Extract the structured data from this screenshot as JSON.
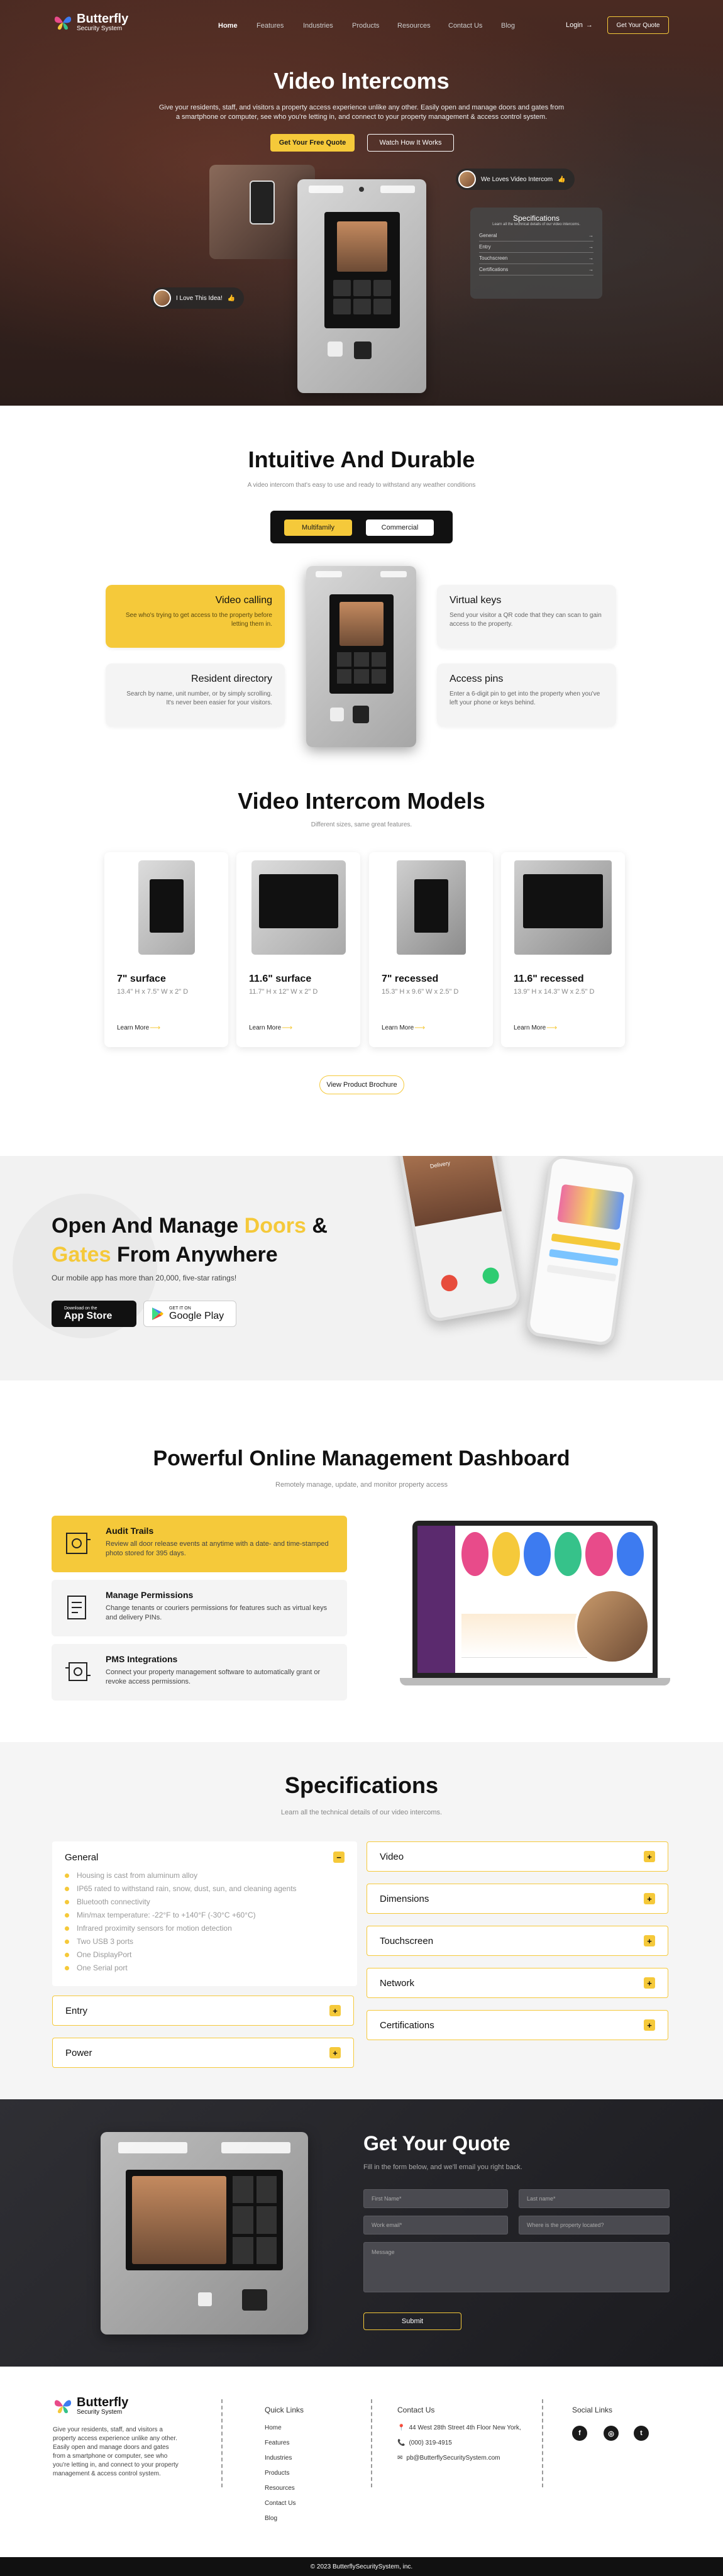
{
  "brand": {
    "name": "Butterfly",
    "tagline": "Security System"
  },
  "nav": {
    "items": [
      "Home",
      "Features",
      "Industries",
      "Products",
      "Resources",
      "Contact Us",
      "Blog"
    ],
    "login": "Login",
    "cta": "Get Your Quote"
  },
  "hero": {
    "title": "Video Intercoms",
    "subtitle": "Give your residents, staff, and visitors a property access experience unlike any other. Easily open and manage doors and gates from a smartphone or computer, see who you're letting in, and connect to your property management & access control system.",
    "primary_btn": "Get Your Free Quote",
    "secondary_btn": "Watch How It Works",
    "pill_right": "We Loves Video Intercom",
    "pill_left": "I Love This Idea!",
    "spec_card": {
      "title": "Specifications",
      "subtitle": "Learn all the technical details of our video intercoms.",
      "rows": [
        "General",
        "Entry",
        "Touchscreen",
        "Certifications"
      ]
    }
  },
  "durable": {
    "title": "Intuitive And Durable",
    "subtitle": "A video intercom that's easy to use and ready to withstand any weather conditions",
    "toggle": [
      "Multifamily",
      "Commercial"
    ],
    "features": [
      {
        "title": "Video calling",
        "text": "See who's trying to get access to the property before letting them in."
      },
      {
        "title": "Virtual keys",
        "text": "Send your visitor a QR code that they can scan to gain access to the property."
      },
      {
        "title": "Resident directory",
        "text": "Search by name, unit number, or by simply scrolling. It's never been easier for your visitors."
      },
      {
        "title": "Access pins",
        "text": "Enter a 6-digit pin to get into the property when you've left your phone or keys behind."
      }
    ]
  },
  "models": {
    "title": "Video Intercom Models",
    "subtitle": "Different sizes, same great features.",
    "items": [
      {
        "name": "7\" surface",
        "dims": "13.4\" H x 7.5\" W x 2\" D",
        "link": "Learn More"
      },
      {
        "name": "11.6\" surface",
        "dims": "11.7\" H x 12\" W x 2\" D",
        "link": "Learn More"
      },
      {
        "name": "7\" recessed",
        "dims": "15.3\" H x 9.6\" W x 2.5\" D",
        "link": "Learn More"
      },
      {
        "name": "11.6\" recessed",
        "dims": "13.9\" H x 14.3\" W x 2.5\" D",
        "link": "Learn More"
      }
    ],
    "brochure_btn": "View Product Brochure"
  },
  "app": {
    "title_a": "Open And Manage ",
    "title_hl1": "Doors",
    "title_b": " & ",
    "title_hl2": "Gates",
    "title_c": " From Anywhere",
    "subtitle": "Our mobile app has more than 20,000, five-star ratings!",
    "app_store": {
      "small": "Download on the",
      "big": "App Store"
    },
    "google_play": {
      "small": "GET IT ON",
      "big": "Google Play"
    },
    "phone_label": "Delivery",
    "colors": {
      "accent": "#f5c93a",
      "call_accept": "#2ecc71",
      "call_decline": "#e74c3c"
    }
  },
  "dashboard": {
    "title": "Powerful Online Management Dashboard",
    "subtitle": "Remotely manage, update, and monitor property access",
    "items": [
      {
        "title": "Audit Trails",
        "text": "Review all door release events at anytime with a date- and time-stamped photo stored for 395 days."
      },
      {
        "title": "Manage Permissions",
        "text": "Change tenants or couriers permissions for features such as virtual keys and delivery PINs."
      },
      {
        "title": "PMS Integrations",
        "text": "Connect your property management software to automatically grant or revoke access permissions."
      }
    ]
  },
  "specs": {
    "title": "Specifications",
    "subtitle": "Learn all the technical details of our video intercoms.",
    "general": {
      "label": "General",
      "toggle": "−",
      "items": [
        "Housing is cast from aluminum alloy",
        "IP65 rated to withstand rain, snow, dust, sun, and cleaning agents",
        "Bluetooth connectivity",
        "Min/max temperature: -22°F to +140°F (-30°C +60°C)",
        "Infrared proximity sensors for motion detection",
        "Two USB 3 ports",
        "One DisplayPort",
        "One Serial port"
      ]
    },
    "left_more": [
      "Entry",
      "Power"
    ],
    "right": [
      "Video",
      "Dimensions",
      "Touchscreen",
      "Network",
      "Certifications"
    ],
    "plus": "+"
  },
  "quote": {
    "title": "Get Your Quote",
    "subtitle": "Fill in the form below, and we'll email you right back.",
    "fields": [
      "First Name*",
      "Last name*",
      "Work email*",
      "Where is the property located?",
      "Message"
    ],
    "submit": "Submit"
  },
  "footer": {
    "about": "Give your residents, staff, and visitors a property access experience unlike any other. Easily open and manage doors and gates from a smartphone or computer, see who you're letting in, and connect to your property management & access control system.",
    "quick_links_title": "Quick Links",
    "quick_links": [
      "Home",
      "Features",
      "Industries",
      "Products",
      "Resources",
      "Contact Us",
      "Blog"
    ],
    "contact_title": "Contact Us",
    "address": "44 West 28th Street 4th Floor New York,",
    "phone": "(000) 319-4915",
    "email": "pb@ButterflySecuritySystem.com",
    "social_title": "Social Links",
    "copyright": "© 2023 ButterflySecuritySystem, inc."
  }
}
